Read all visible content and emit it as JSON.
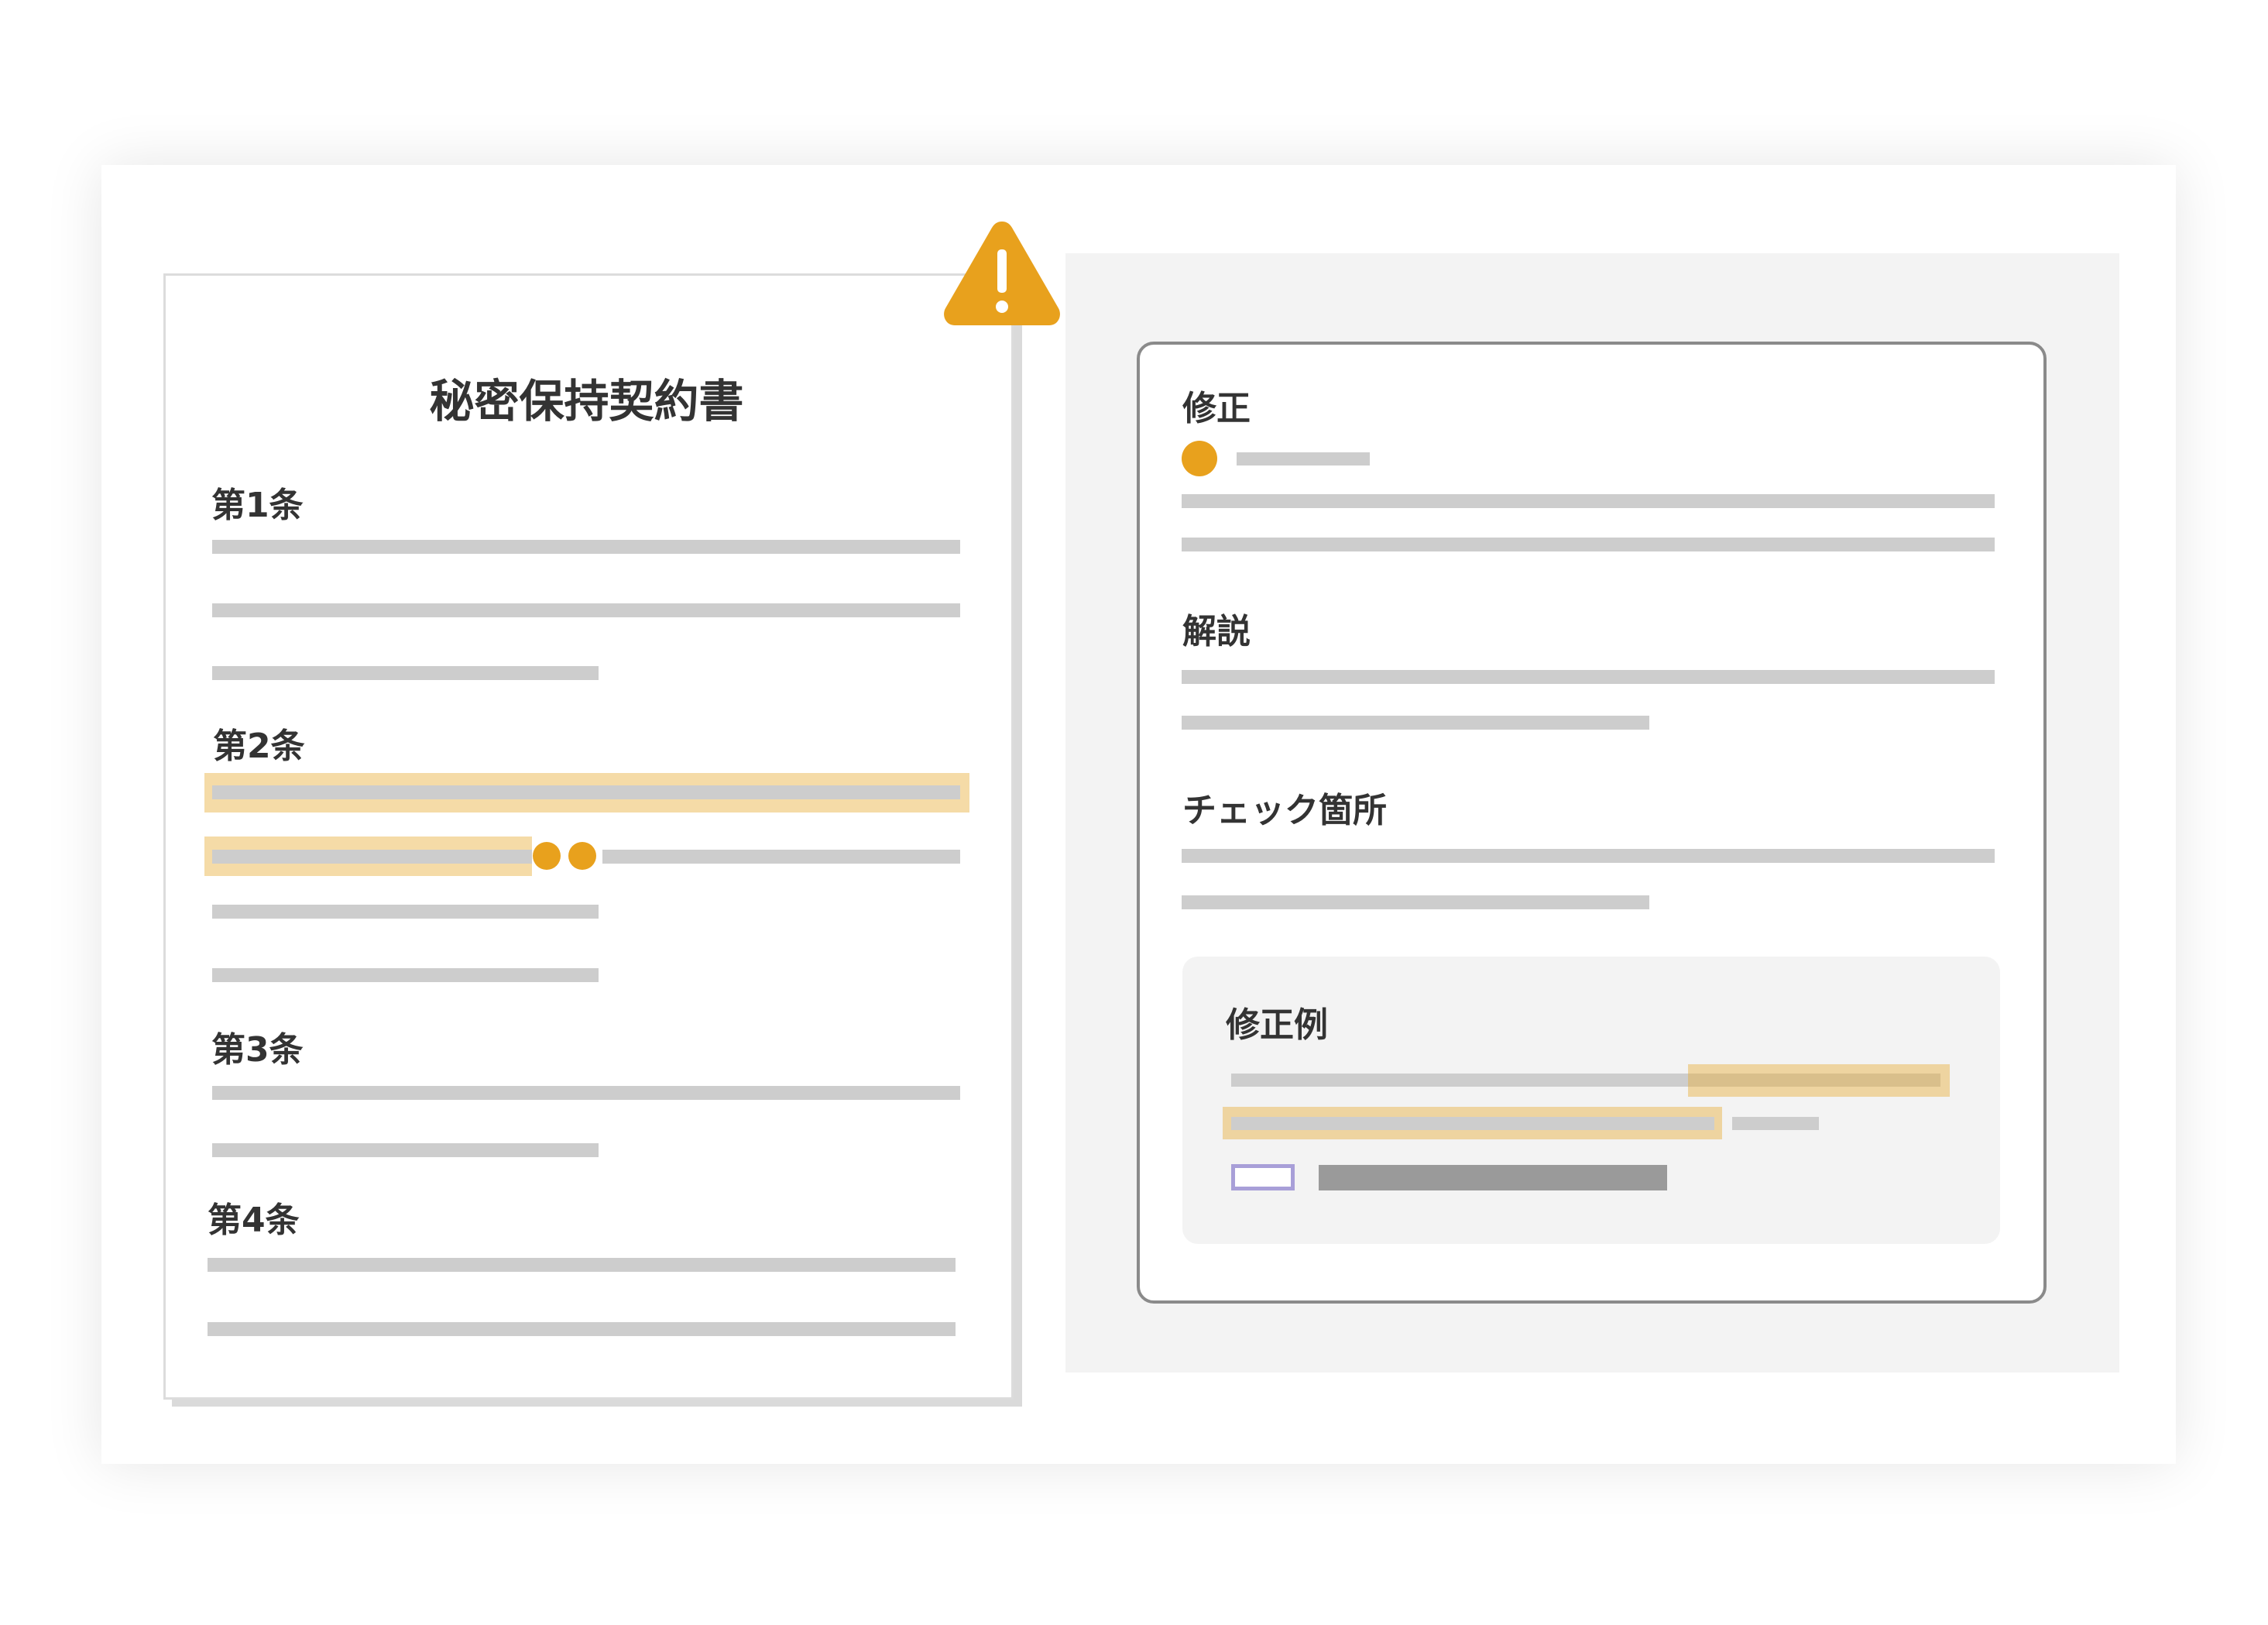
{
  "document": {
    "title": "秘密保持契約書",
    "articles": [
      "第1条",
      "第2条",
      "第3条",
      "第4条"
    ]
  },
  "warning": {
    "icon": "warning-triangle-icon",
    "symbol": "!",
    "color": "#e8a11d"
  },
  "review_panel": {
    "fix_heading": "修正",
    "explanation_heading": "解説",
    "check_heading": "チェック箇所",
    "example_heading": "修正例"
  },
  "colors": {
    "accent": "#e8a11d",
    "highlight": "#f1d99f",
    "placeholder_line": "#cdcdcd",
    "button_outline": "#a89fd8"
  }
}
